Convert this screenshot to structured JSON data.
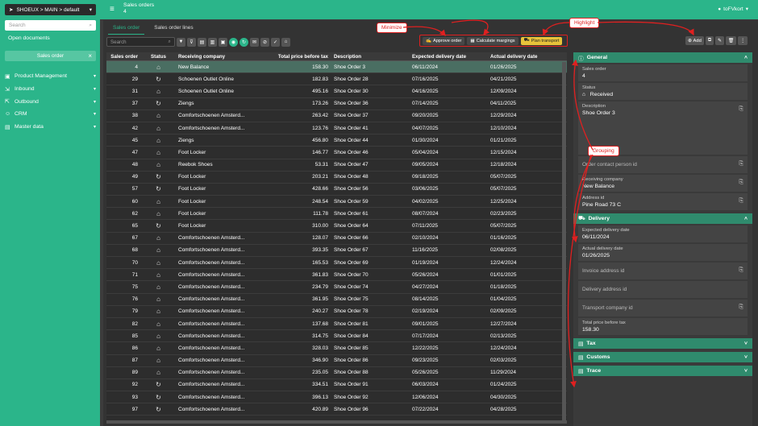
{
  "workspace": {
    "label": "SHOEUX > MAIN > default"
  },
  "sidebar": {
    "search_placeholder": "Search",
    "open_documents": "Open documents",
    "open_tab": "Sales order",
    "items": [
      {
        "icon": "box-icon",
        "label": "Product Management"
      },
      {
        "icon": "inbound-icon",
        "label": "Inbound"
      },
      {
        "icon": "outbound-icon",
        "label": "Outbound"
      },
      {
        "icon": "crm-icon",
        "label": "CRM"
      },
      {
        "icon": "database-icon",
        "label": "Master data"
      }
    ]
  },
  "header": {
    "title": "Sales orders",
    "count": "4",
    "user": "toFVkort"
  },
  "tabs": [
    "Sales order",
    "Sales order lines"
  ],
  "toolbar": {
    "search_placeholder": "Search",
    "approve": "Approve order",
    "margins": "Calculate margings",
    "plan": "Plan transport",
    "add": "Add"
  },
  "annotations": {
    "minimize": "Minimize",
    "highlight": "Highlight",
    "grouping": "Grouping"
  },
  "table": {
    "columns": [
      "Sales order",
      "Status",
      "Receiving company",
      "Total price before tax",
      "Description",
      "Expected delivery date",
      "Actual delivery date"
    ],
    "rows": [
      [
        "4",
        "received",
        "New Balance",
        "158.30",
        "Shoe Order 3",
        "06/11/2024",
        "01/26/2025"
      ],
      [
        "29",
        "processing",
        "Schoenen Outlet Online",
        "182.83",
        "Shoe Order 28",
        "07/16/2025",
        "04/21/2025"
      ],
      [
        "31",
        "received",
        "Schoenen Outlet Online",
        "495.16",
        "Shoe Order 30",
        "04/16/2025",
        "12/09/2024"
      ],
      [
        "37",
        "processing",
        "Ziengs",
        "173.26",
        "Shoe Order 36",
        "07/14/2025",
        "04/11/2025"
      ],
      [
        "38",
        "received",
        "Comfortschoenen Amsterd...",
        "263.42",
        "Shoe Order 37",
        "09/20/2025",
        "12/29/2024"
      ],
      [
        "42",
        "received",
        "Comfortschoenen Amsterd...",
        "123.76",
        "Shoe Order 41",
        "04/07/2025",
        "12/10/2024"
      ],
      [
        "45",
        "received",
        "Ziengs",
        "456.80",
        "Shoe Order 44",
        "01/30/2024",
        "01/21/2025"
      ],
      [
        "47",
        "received",
        "Foot Locker",
        "146.77",
        "Shoe Order 46",
        "05/04/2024",
        "12/15/2024"
      ],
      [
        "48",
        "received",
        "Reebok Shoes",
        "53.31",
        "Shoe Order 47",
        "09/05/2024",
        "12/18/2024"
      ],
      [
        "49",
        "processing",
        "Foot Locker",
        "203.21",
        "Shoe Order 48",
        "09/18/2025",
        "05/07/2025"
      ],
      [
        "57",
        "processing",
        "Foot Locker",
        "428.66",
        "Shoe Order 56",
        "03/06/2025",
        "05/07/2025"
      ],
      [
        "60",
        "received",
        "Foot Locker",
        "248.54",
        "Shoe Order 59",
        "04/02/2025",
        "12/25/2024"
      ],
      [
        "62",
        "received",
        "Foot Locker",
        "111.78",
        "Shoe Order 61",
        "08/07/2024",
        "02/23/2025"
      ],
      [
        "65",
        "processing",
        "Foot Locker",
        "310.00",
        "Shoe Order 64",
        "07/11/2025",
        "05/07/2025"
      ],
      [
        "67",
        "received",
        "Comfortschoenen Amsterd...",
        "128.07",
        "Shoe Order 66",
        "02/10/2024",
        "01/16/2025"
      ],
      [
        "68",
        "received",
        "Comfortschoenen Amsterd...",
        "393.35",
        "Shoe Order 67",
        "11/16/2025",
        "02/08/2025"
      ],
      [
        "70",
        "received",
        "Comfortschoenen Amsterd...",
        "165.53",
        "Shoe Order 69",
        "01/19/2024",
        "12/24/2024"
      ],
      [
        "71",
        "received",
        "Comfortschoenen Amsterd...",
        "361.83",
        "Shoe Order 70",
        "05/26/2024",
        "01/01/2025"
      ],
      [
        "75",
        "received",
        "Comfortschoenen Amsterd...",
        "234.79",
        "Shoe Order 74",
        "04/27/2024",
        "01/18/2025"
      ],
      [
        "76",
        "received",
        "Comfortschoenen Amsterd...",
        "361.95",
        "Shoe Order 75",
        "08/14/2025",
        "01/04/2025"
      ],
      [
        "79",
        "received",
        "Comfortschoenen Amsterd...",
        "240.27",
        "Shoe Order 78",
        "02/19/2024",
        "02/09/2025"
      ],
      [
        "82",
        "received",
        "Comfortschoenen Amsterd...",
        "137.68",
        "Shoe Order 81",
        "09/01/2025",
        "12/27/2024"
      ],
      [
        "85",
        "received",
        "Comfortschoenen Amsterd...",
        "314.75",
        "Shoe Order 84",
        "07/17/2024",
        "02/13/2025"
      ],
      [
        "86",
        "received",
        "Comfortschoenen Amsterd...",
        "328.03",
        "Shoe Order 85",
        "12/22/2025",
        "12/24/2024"
      ],
      [
        "87",
        "received",
        "Comfortschoenen Amsterd...",
        "346.90",
        "Shoe Order 86",
        "09/23/2025",
        "02/03/2025"
      ],
      [
        "89",
        "received",
        "Comfortschoenen Amsterd...",
        "235.05",
        "Shoe Order 88",
        "05/26/2025",
        "11/29/2024"
      ],
      [
        "92",
        "processing",
        "Comfortschoenen Amsterd...",
        "334.51",
        "Shoe Order 91",
        "06/03/2024",
        "01/24/2025"
      ],
      [
        "93",
        "processing",
        "Comfortschoenen Amsterd...",
        "396.13",
        "Shoe Order 92",
        "12/06/2024",
        "04/30/2025"
      ],
      [
        "97",
        "processing",
        "Comfortschoenen Amsterd...",
        "420.89",
        "Shoe Order 96",
        "07/22/2024",
        "04/28/2025"
      ]
    ]
  },
  "detail": {
    "general": "General",
    "sales_order_label": "Sales order",
    "sales_order_value": "4",
    "status_label": "Status",
    "status_value": "Received",
    "description_label": "Description",
    "description_value": "Shoe Order 3",
    "order_contact": "Order contact person id",
    "receiving_label": "Receiving company",
    "receiving_value": "New Balance",
    "address_label": "Address id",
    "address_value": "Pine Road 73 C",
    "delivery": "Delivery",
    "expected_label": "Expected delivery date",
    "expected_value": "06/11/2024",
    "actual_label": "Actual delivery date",
    "actual_value": "01/26/2025",
    "invoice": "Invoice address id",
    "delivery_addr": "Delivery address id",
    "transport": "Transport company id",
    "total_label": "Total price before tax",
    "total_value": "158.30",
    "tax": "Tax",
    "customs": "Customs",
    "trace": "Trace"
  },
  "colors": {
    "accent": "#2bb58a",
    "annotation": "#e02020",
    "highlight": "#e8c33a"
  }
}
